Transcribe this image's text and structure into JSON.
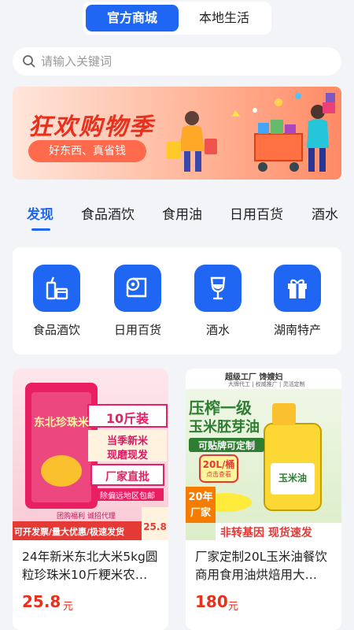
{
  "top_tabs": {
    "official": "官方商城",
    "local": "本地生活"
  },
  "search": {
    "placeholder": "请输入关键词"
  },
  "banner": {
    "title": "狂欢购物季",
    "subtitle": "好东西、真省钱"
  },
  "category_tabs": [
    "发现",
    "食品酒饮",
    "食用油",
    "日用百货",
    "酒水"
  ],
  "categories": [
    {
      "label": "食品酒饮",
      "icon": "drinks-food-icon"
    },
    {
      "label": "日用百货",
      "icon": "tissue-roll-icon"
    },
    {
      "label": "酒水",
      "icon": "wine-glass-icon"
    },
    {
      "label": "湖南特产",
      "icon": "gift-box-icon"
    }
  ],
  "products": [
    {
      "name": "24年新米东北大米5kg圆粒珍珠米10斤粳米农…",
      "price": "25.8",
      "unit": "元",
      "image_text": {
        "bag": "东北珍珠米",
        "weight": "10斤装",
        "tag1": "当季新米",
        "tag2": "现磨现发",
        "direct": "厂家直批",
        "shipping": "除偏远地区包邮",
        "welfare": "团购福利 诚招代理",
        "bottom": "可开发票/量大优惠/极速发货",
        "price_box": "25.8"
      }
    },
    {
      "name": "厂家定制20L玉米油餐饮商用食用油烘焙用大…",
      "price": "180",
      "unit": "元",
      "image_text": {
        "brand": "超级工厂 馋嫂妇",
        "brand_sub": "大牌代工 | 权威推广 | 灵活定制",
        "line1": "压榨一级",
        "line2": "玉米胚芽油",
        "custom": "可贴牌可定制",
        "size": "20L/桶",
        "size_sub": "点击查看",
        "bottle": "玉米油",
        "years": "20年",
        "factory": "厂家",
        "bottom": "非转基因 现货速发"
      }
    }
  ]
}
